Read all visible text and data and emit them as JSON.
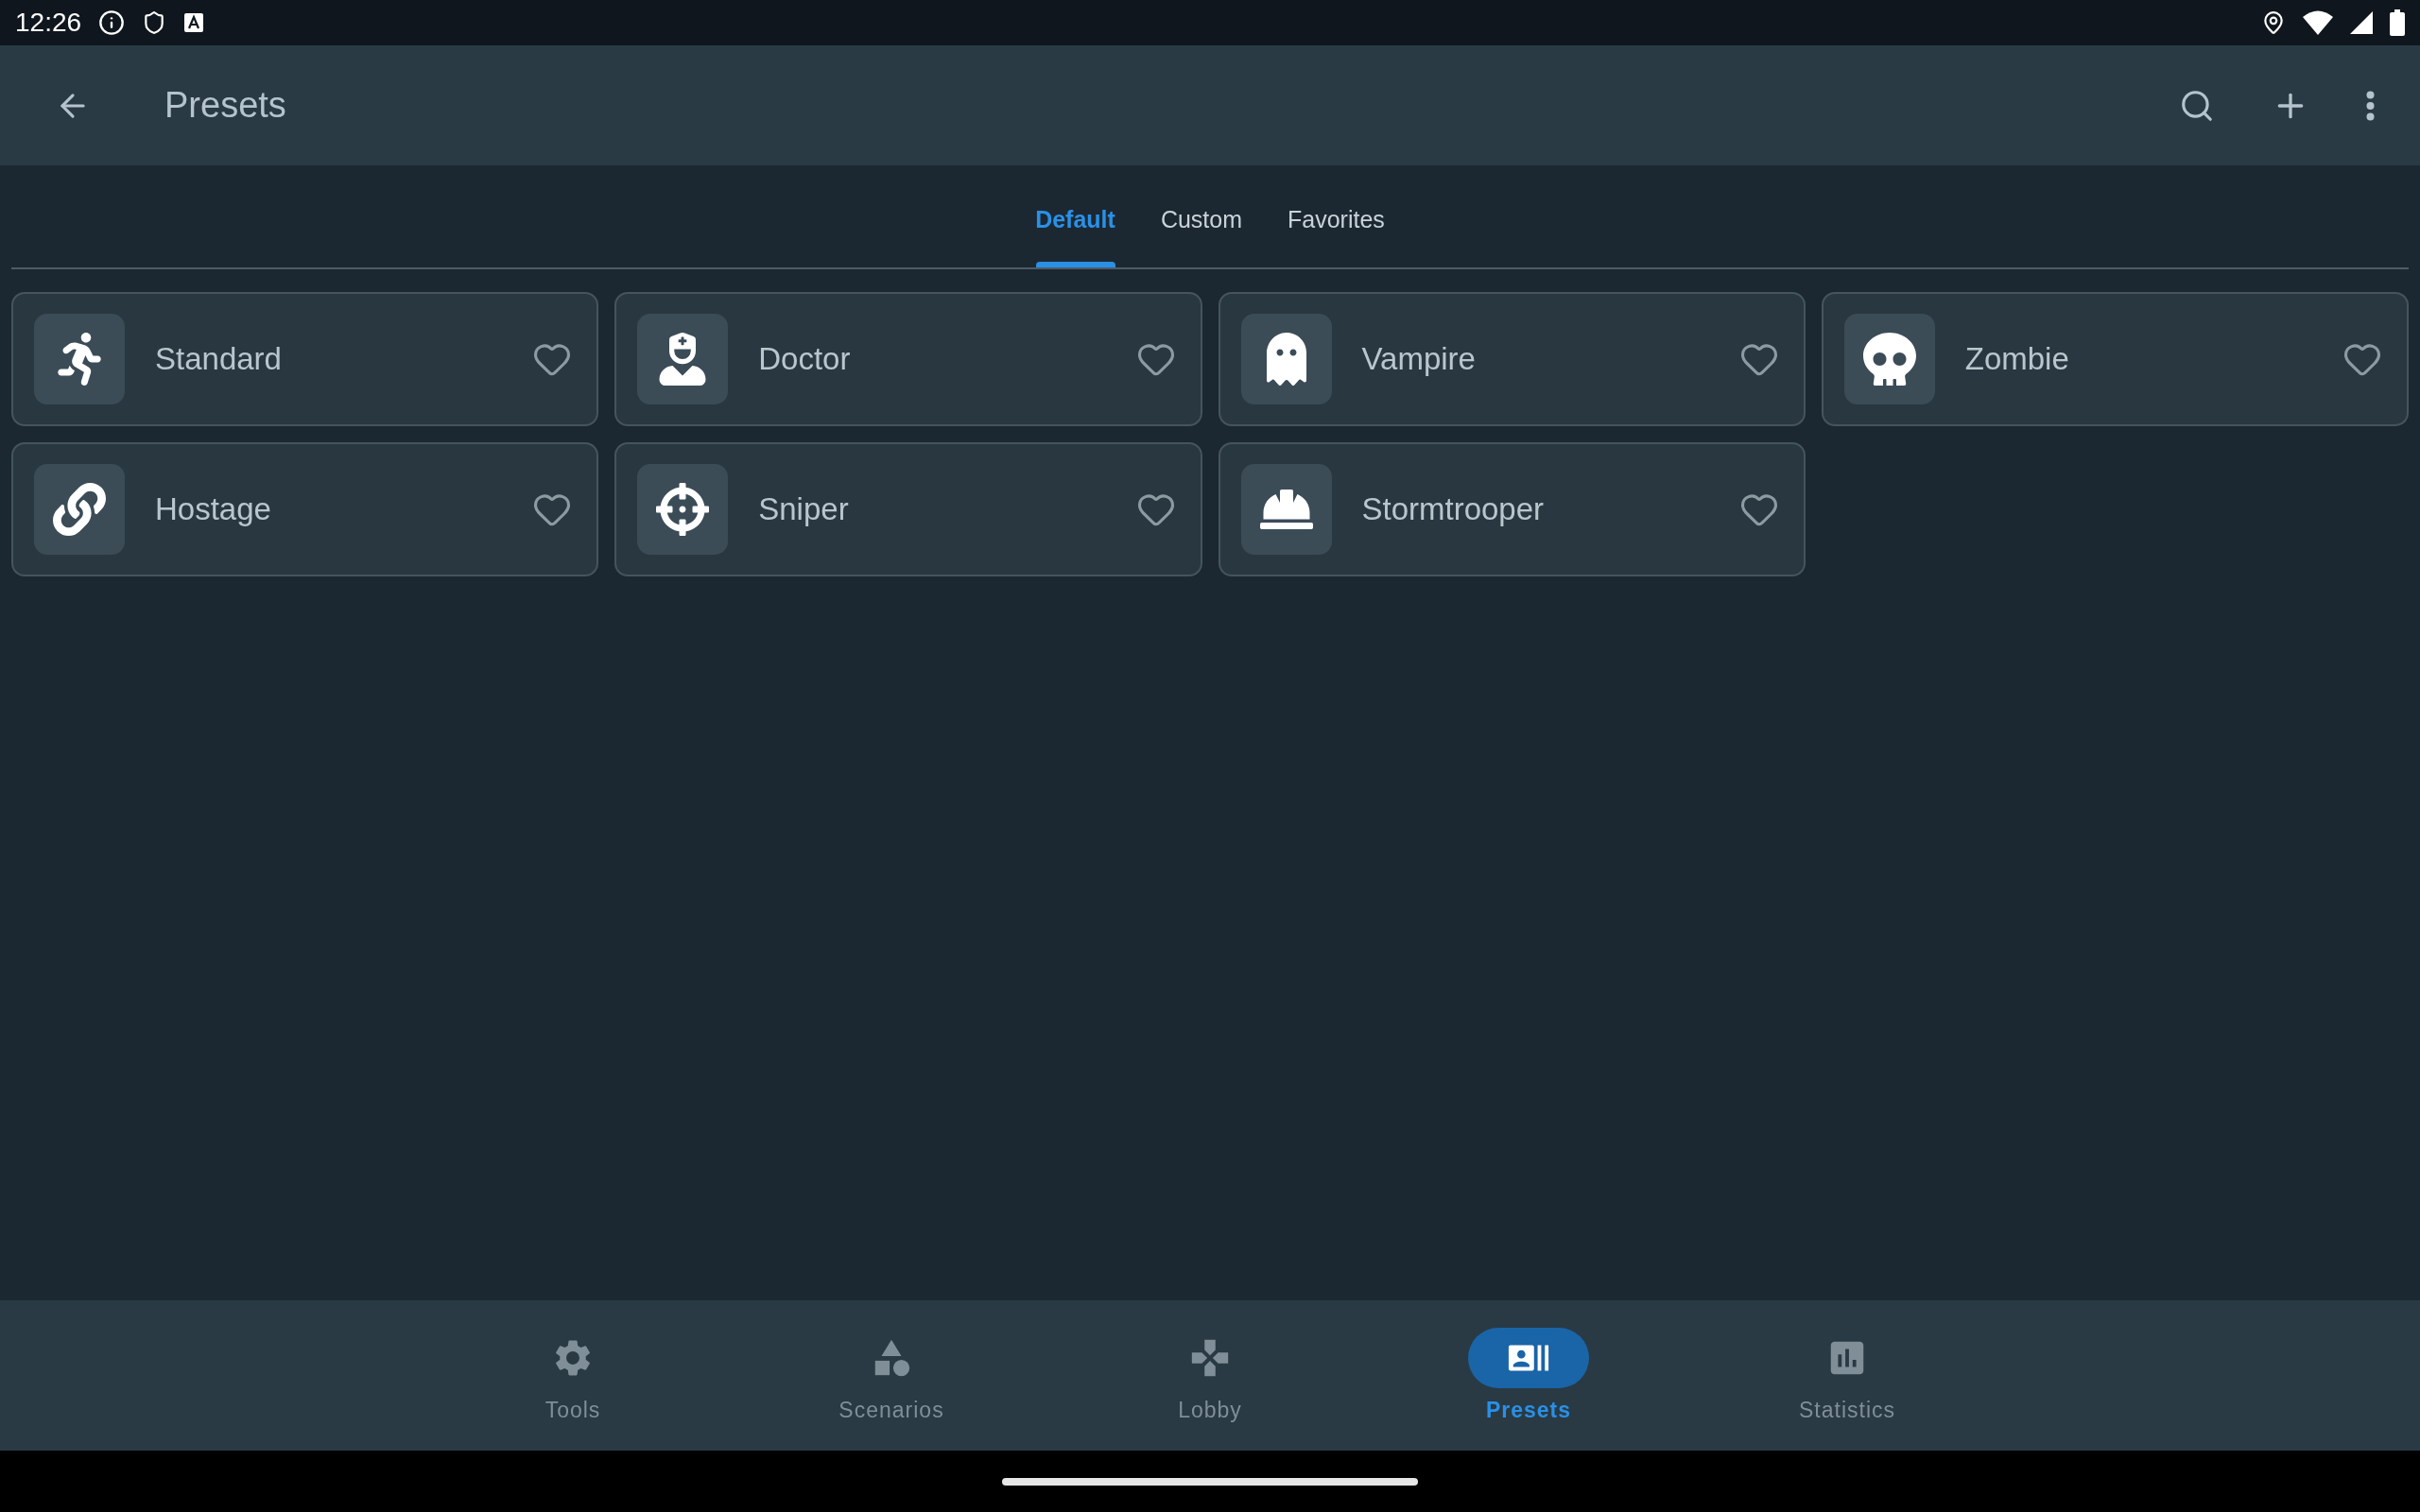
{
  "status_bar": {
    "time": "12:26"
  },
  "app_bar": {
    "title": "Presets"
  },
  "tabs": [
    {
      "label": "Default",
      "selected": true
    },
    {
      "label": "Custom",
      "selected": false
    },
    {
      "label": "Favorites",
      "selected": false
    }
  ],
  "presets": [
    {
      "name": "Standard",
      "favorite": false
    },
    {
      "name": "Doctor",
      "favorite": false
    },
    {
      "name": "Vampire",
      "favorite": false
    },
    {
      "name": "Zombie",
      "favorite": false
    },
    {
      "name": "Hostage",
      "favorite": false
    },
    {
      "name": "Sniper",
      "favorite": false
    },
    {
      "name": "Stormtrooper",
      "favorite": false
    }
  ],
  "bottom_nav": [
    {
      "label": "Tools",
      "selected": false
    },
    {
      "label": "Scenarios",
      "selected": false
    },
    {
      "label": "Lobby",
      "selected": false
    },
    {
      "label": "Presets",
      "selected": true
    },
    {
      "label": "Statistics",
      "selected": false
    }
  ]
}
